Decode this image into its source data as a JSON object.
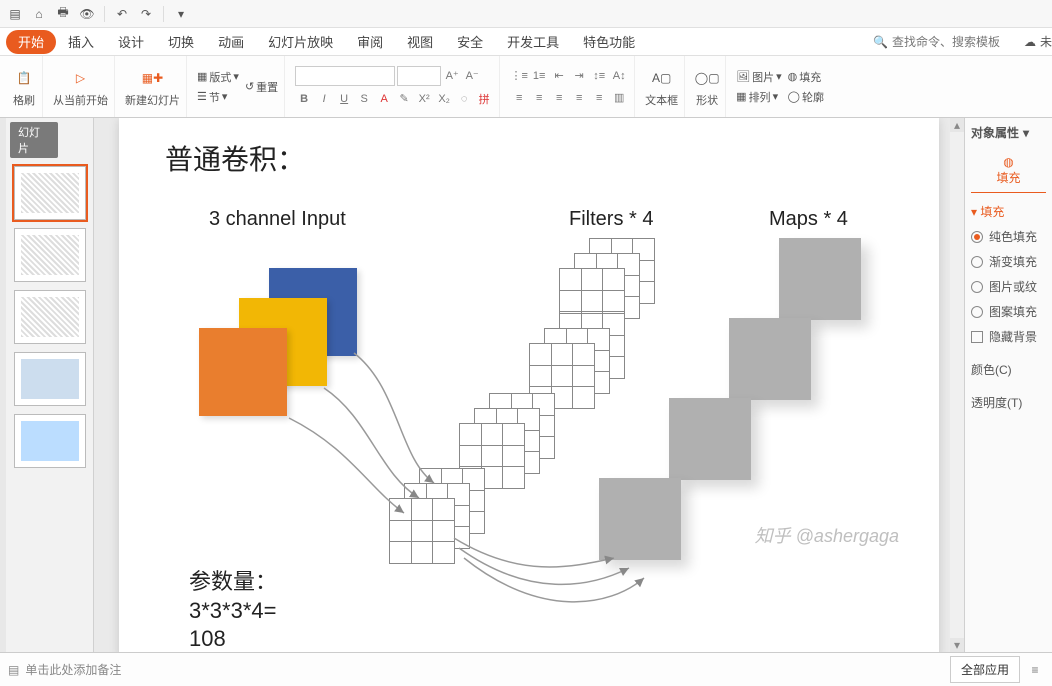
{
  "titlebar": {
    "icons": [
      "save",
      "home",
      "print",
      "preview",
      "undo",
      "redo"
    ]
  },
  "tabs": {
    "items": [
      "开始",
      "插入",
      "设计",
      "切换",
      "动画",
      "幻灯片放映",
      "审阅",
      "视图",
      "安全",
      "开发工具",
      "特色功能"
    ],
    "active": 0,
    "search_placeholder": "查找命令、搜索模板",
    "search_icon": "🔍",
    "right_extra": "未"
  },
  "ribbon": {
    "format_painter": "格刷",
    "from_current": "从当前开始",
    "new_slide": "新建幻灯片",
    "layout": "版式",
    "reset": "重置",
    "section": "节",
    "font_name": "",
    "font_size": "",
    "textbox": "文本框",
    "shapes": "形状",
    "picture": "图片",
    "arrange": "排列",
    "fill": "填充",
    "outline": "轮廓"
  },
  "thumbs": {
    "header": "幻灯片",
    "count": 5,
    "active": 0
  },
  "slide": {
    "title": "普通卷积：",
    "label_input": "3 channel Input",
    "label_filters": "Filters * 4",
    "label_maps": "Maps * 4",
    "param_title": "参数量：",
    "param_expr": "3*3*3*4=",
    "param_result": "108",
    "watermark": "知乎 @ashergaga"
  },
  "rpanel": {
    "header": "对象属性",
    "tab": "填充",
    "section": "填充",
    "opt_solid": "纯色填充",
    "opt_gradient": "渐变填充",
    "opt_picture": "图片或纹",
    "opt_pattern": "图案填充",
    "opt_hidebg": "隐藏背景",
    "color": "颜色(C)",
    "transparency": "透明度(T)"
  },
  "bottom": {
    "notes_placeholder": "单击此处添加备注",
    "apply_all": "全部应用"
  }
}
